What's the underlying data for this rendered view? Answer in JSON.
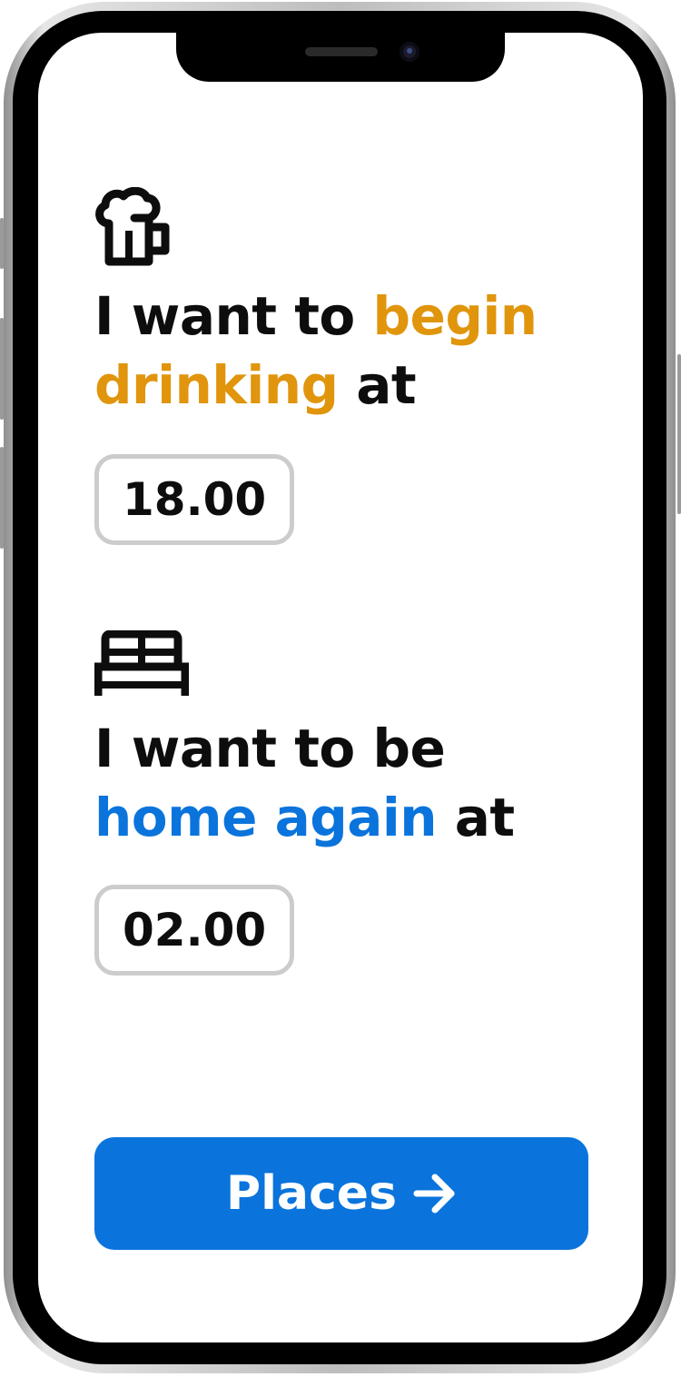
{
  "drink": {
    "prefix": "I want to ",
    "highlight": "begin drinking",
    "suffix": " at",
    "time": "18.00",
    "icon": "beer-mug-icon"
  },
  "home": {
    "prefix": "I want to be ",
    "highlight": "home again",
    "suffix": " at",
    "time": "02.00",
    "icon": "bed-icon"
  },
  "cta": {
    "label": "Places",
    "icon": "arrow-right-icon"
  },
  "colors": {
    "drink_highlight": "#e0950d",
    "home_highlight": "#0a74dc",
    "button": "#0a74dc"
  }
}
